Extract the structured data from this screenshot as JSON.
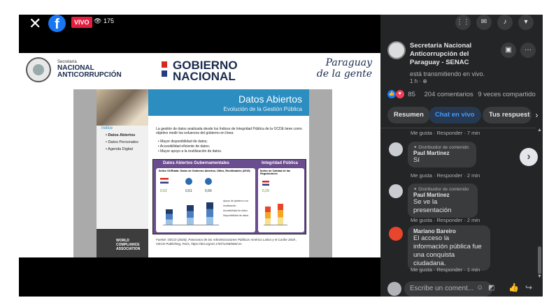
{
  "video": {
    "viewers": "175",
    "live_label": "VIVO",
    "fb_logo": "f",
    "close": "✕"
  },
  "slide": {
    "org_small": "Secretaría",
    "org_line1": "NACIONAL",
    "org_line2": "ANTICORRUPCIÓN",
    "gob_line1": "GOBIERNO",
    "gob_line2": "NACIONAL",
    "pyg_line1": "Paraguay",
    "pyg_line2": "de la gente",
    "title": "Datos Abiertos",
    "subtitle": "Evolución de la Gestión Pública",
    "indice": "Índice",
    "menu": [
      "• Datos Abiertos",
      "• Datos Personales",
      "• Agenda Digital"
    ],
    "intro": "La gestión de datos analizada desde los Índices de Integridad Pública de la OCDE tiene como objetivo medir los esfuerzos del gobierno en línea:",
    "bullets": [
      "• Mayor disponibilidad de datos;",
      "• Accesibilidad eficiente de datos;",
      "• Mayor apoyo a la reutilización de datos."
    ],
    "box1_title": "Datos Abiertos Gubernamentales",
    "box2_title": "Integridad Pública",
    "box1_chart_title": "Índice OURdata: Datos de Gobierno Abiertos, Útiles, Reutilizables (2019)",
    "box2_chart_title": "Índice de Calidad de las Regulaciones",
    "vals": [
      "0,52",
      "0,61",
      "0,66"
    ],
    "val2": "0,29",
    "legend": [
      "Apoyo de gobierno a la reutilización",
      "Accesibilidad de datos",
      "Disponibilidad de datos"
    ],
    "wca_line1": "WORLD",
    "wca_line2": "COMPLIANCE",
    "wca_line3": "ASSOCIATION",
    "footnote": "Fuente: OECD (2020), Panorama de las Administraciones Públicas América Latina y el Caribe 2020 , OECD Publishing, Paris, https://doi.org/10.1787/1256b68d-es"
  },
  "fb": {
    "page_name": "Secretaría Nacional Anticorrupción del Paraguay - SENAC",
    "status": "está transmitiendo en vivo.",
    "time": "1 h · ",
    "reactions_count": "85",
    "comments_count": "204 comentarios",
    "shares": "9 veces compartido",
    "tabs": [
      "Resumen",
      "Chat en vivo",
      "Tus respuest"
    ],
    "meta_top": "Me gusta · Responder · 7 min",
    "comments": [
      {
        "badge": "Distribuidor de contenido",
        "author": "Paul Martinez",
        "text": "Sí",
        "meta": "Me gusta · Responder · 2 min"
      },
      {
        "badge": "Distribuidor de contenido",
        "author": "Paul Martinez",
        "text": "Se ve la presentación",
        "meta": "Me gusta · Responder · 2 min"
      },
      {
        "badge": "",
        "author": "Mariano Bareiro",
        "text": "El acceso la información pública fue una conquista ciudadana.",
        "meta": "Me gusta · Responder · 1 min"
      }
    ],
    "comment_placeholder": "Escribe un coment..."
  }
}
